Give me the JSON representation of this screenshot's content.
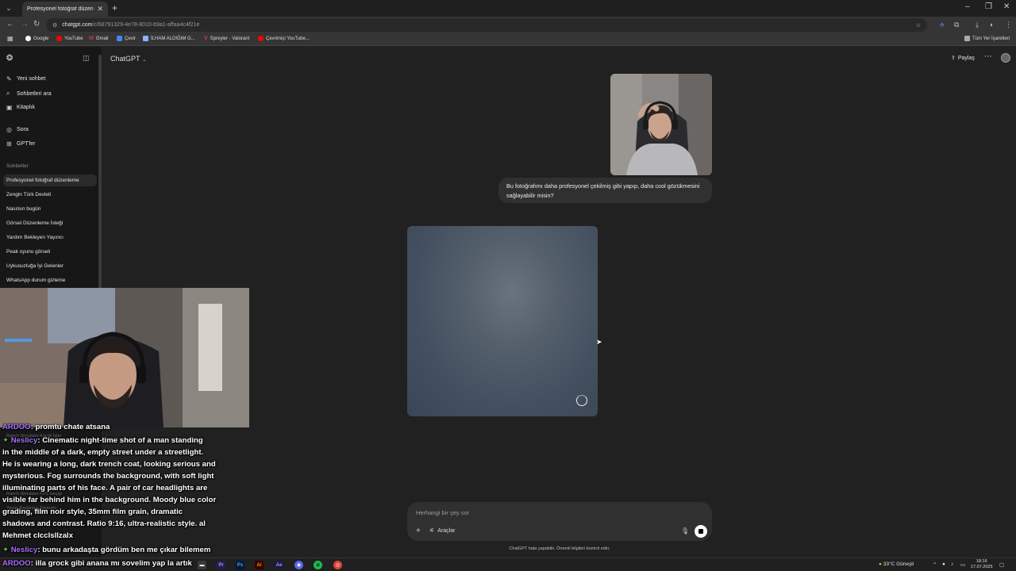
{
  "browser": {
    "tab_title": "Profesyonel fotoğraf düzenleme",
    "url_domain": "chatgpt.com",
    "url_path": "/c/68791329-4e78-8010-b9a1-affaa4c4f21e",
    "bookmarks": [
      "Google",
      "YouTube",
      "Gmail",
      "Çevir",
      "İLHAM ALDIĞIM G...",
      "Spreyler - Valorant",
      "Çevrimiçi YouTube..."
    ],
    "all_bookmarks": "Tüm Yer İşaretleri",
    "accent_colors": {
      "google": "#ffffff",
      "youtube": "#ff0000",
      "gmail": "#ea4335",
      "translate": "#4285f4",
      "valorant": "#ff4655"
    }
  },
  "sidebar": {
    "nav": [
      {
        "label": "Yeni sohbet",
        "icon": "pencil-icon"
      },
      {
        "label": "Sohbetleri ara",
        "icon": "search-icon"
      },
      {
        "label": "Kitaplık",
        "icon": "library-icon"
      },
      {
        "label": "Sora",
        "icon": "sora-icon"
      },
      {
        "label": "GPT'ler",
        "icon": "grid-icon"
      }
    ],
    "section_title": "Sohbetler",
    "chats": [
      "Profesyonel fotoğraf düzenleme",
      "Zengin Türk Devleti",
      "Nasılsın bugün",
      "Görsel Düzenleme İsteği",
      "Yardım Bekleyen Yayıncı",
      "Peak oyunu görseli",
      "Uykusuzluğa İyi Gelenler",
      "WhatsApp durum gizleme"
    ]
  },
  "header": {
    "model": "ChatGPT",
    "share": "Paylaş"
  },
  "conversation": {
    "user_message": "Bu fotoğrafımı daha profesyonel çekilmiş gibi yapıp, daha cool gözükmesini sağlayabilir misin?"
  },
  "composer": {
    "placeholder": "Herhangi bir şey sor",
    "tools": "Araçlar",
    "disclaimer": "ChatGPT hata yapabilir. Önemli bilgileri kontrol edin."
  },
  "stream_chat": {
    "lines": [
      {
        "user": "ARDOO",
        "text": ": promtu chate atsana"
      },
      {
        "user": "Neslicy",
        "text": ": Cinematic night-time shot of a man standing"
      },
      {
        "user": "",
        "text": "in the middle of a dark, empty street under a streetlight."
      },
      {
        "user": "",
        "text": "He is wearing a long, dark trench coat, looking serious and"
      },
      {
        "user": "",
        "text": "mysterious. Fog surrounds the background, with soft light"
      },
      {
        "user": "",
        "text": "illuminating parts of his face. A pair of car headlights are"
      },
      {
        "user": "",
        "text": "visible far behind him in the background. Moody blue color"
      },
      {
        "user": "",
        "text": "grading, film noir style, 35mm film grain, dramatic"
      },
      {
        "user": "",
        "text": "shadows and contrast. Ratio 9:16, ultra-realistic style. al"
      },
      {
        "user": "",
        "text": "Mehmet clcclsllzalx"
      },
      {
        "user": "Neslicy",
        "text": ": bunu arkadaşta gördüm ben me çıkar bilemem"
      },
      {
        "user": "ARDOO",
        "text": ": illa grock gibi anana mı sovelim yap la artık"
      }
    ],
    "ghost_items": [
      "Ranch Simulator Küçük İşler",
      "Ranch Simulator FPS Geçişi",
      "Yavaş Başlangıç Tasarımı"
    ]
  },
  "taskbar": {
    "weather": "33°C  Güneşli",
    "time": "18:16",
    "date": "17.07.2025"
  }
}
